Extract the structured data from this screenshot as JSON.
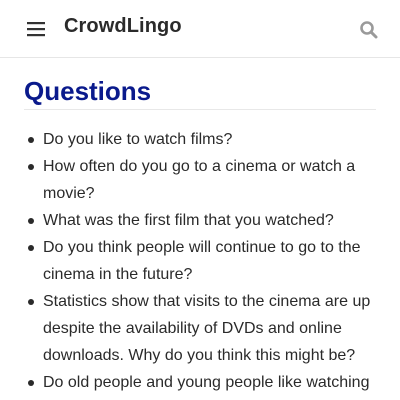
{
  "header": {
    "menu_icon": "hamburger-menu-icon",
    "brand": "CrowdLingo",
    "search_icon": "search-icon"
  },
  "main": {
    "title": "Questions",
    "questions": [
      "Do you like to watch films?",
      "How often do you go to a cinema or watch a movie?",
      "What was the first film that you watched?",
      "Do you think people will continue to go to the cinema in the future?",
      "Statistics show that visits to the cinema are up despite the availability of DVDs and online downloads. Why do you think this might be?",
      "Do old people and young people like watching"
    ]
  },
  "colors": {
    "title": "#0a1a8c",
    "text": "#2a2a2a",
    "icon_gray": "#9a9a9a"
  }
}
